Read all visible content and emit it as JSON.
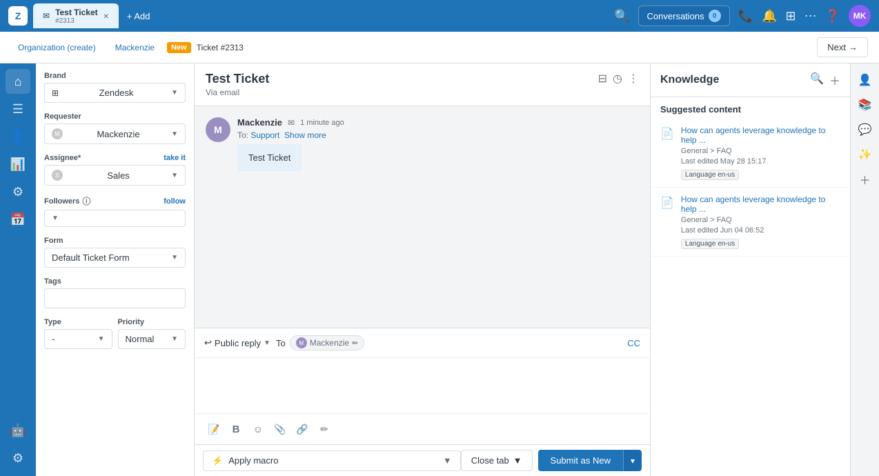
{
  "app": {
    "logo": "Z"
  },
  "topbar": {
    "tab": {
      "title": "Test Ticket",
      "subtitle": "#2313",
      "close_label": "×"
    },
    "add_label": "+ Add",
    "conversations_label": "Conversations",
    "conversations_count": "0"
  },
  "breadcrumb": {
    "org": "Organization (create)",
    "user": "Mackenzie",
    "badge": "New",
    "ticket": "Ticket #2313",
    "next_label": "Next",
    "next_arrow": "→"
  },
  "left_panel": {
    "brand_label": "Brand",
    "brand_value": "Zendesk",
    "requester_label": "Requester",
    "requester_value": "Mackenzie",
    "assignee_label": "Assignee*",
    "take_it_label": "take it",
    "assignee_value": "Sales",
    "followers_label": "Followers",
    "follow_label": "follow",
    "form_label": "Form",
    "form_value": "Default Ticket Form",
    "tags_label": "Tags",
    "type_label": "Type",
    "type_value": "-",
    "priority_label": "Priority",
    "priority_value": "Normal"
  },
  "ticket": {
    "title": "Test Ticket",
    "via": "Via email",
    "message": {
      "sender": "Mackenzie",
      "time": "1 minute ago",
      "to": "Support",
      "show_more": "Show more",
      "body": "Test Ticket"
    }
  },
  "reply": {
    "type_label": "Public reply",
    "to_label": "To",
    "to_user": "Mackenzie",
    "cc_label": "CC",
    "toolbar": {
      "draft": "📝",
      "bold": "B",
      "emoji": "😊",
      "attach": "📎",
      "link": "🔗",
      "more": "✏️"
    }
  },
  "bottom_bar": {
    "macro_label": "Apply macro",
    "close_tab_label": "Close tab",
    "submit_label": "Submit as New",
    "submit_dropdown": "▾"
  },
  "knowledge": {
    "title": "Knowledge",
    "suggested_label": "Suggested content",
    "items": [
      {
        "title": "How can agents leverage knowledge to help ...",
        "category": "General > FAQ",
        "date": "Last edited May 28 15:17",
        "lang": "Language en-us"
      },
      {
        "title": "How can agents leverage knowledge to help ...",
        "category": "General > FAQ",
        "date": "Last edited Jun 04 06:52",
        "lang": "Language en-us"
      }
    ]
  },
  "nav": {
    "items": [
      "🏠",
      "📋",
      "👤",
      "📊",
      "⚙️",
      "📅"
    ],
    "bottom_items": [
      "🤖",
      "⚙️"
    ]
  }
}
